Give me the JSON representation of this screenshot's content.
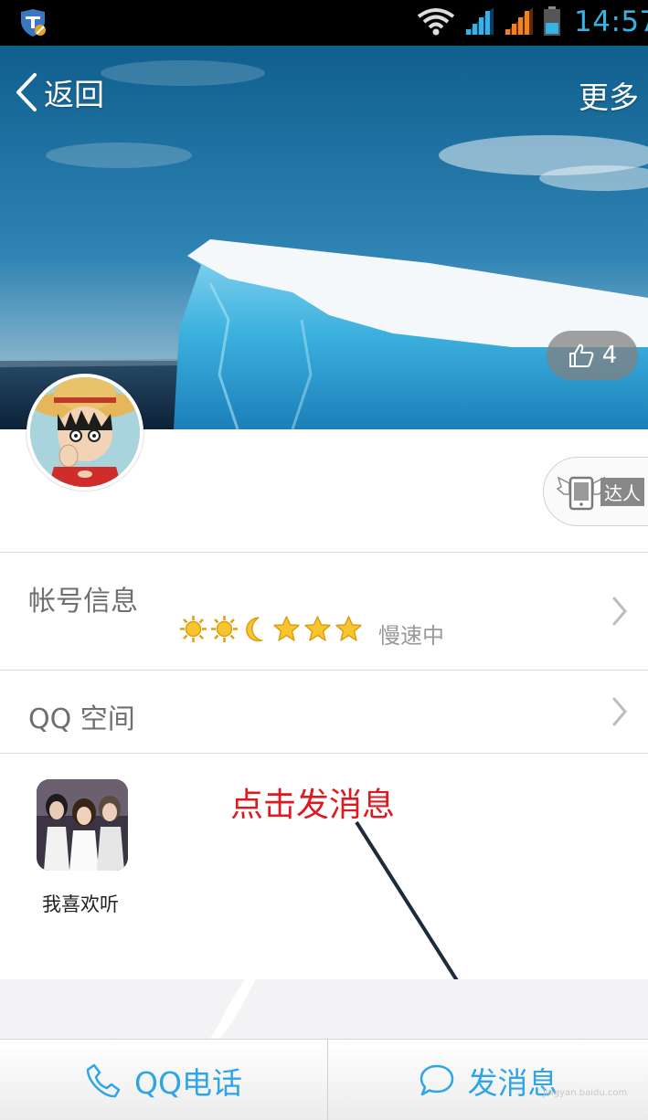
{
  "status_bar": {
    "time": "14:57"
  },
  "header": {
    "back_label": "返回",
    "more_label": "更多"
  },
  "cover": {
    "likes": "4"
  },
  "profile": {
    "badge_label": "达人"
  },
  "account_row": {
    "label": "帐号信息",
    "level_icons": [
      "sun-icon",
      "sun-icon",
      "moon-icon",
      "star-icon",
      "star-icon",
      "star-icon"
    ],
    "speed_text": "慢速中"
  },
  "qzone_row": {
    "label": "QQ 空间"
  },
  "music": {
    "label": "我喜欢听"
  },
  "annotation": {
    "text": "点击发消息"
  },
  "bottom_bar": {
    "call_label": "QQ电话",
    "message_label": "发消息"
  },
  "watermark": {
    "text": "jingyan.baidu.com"
  },
  "colors": {
    "accent": "#2fa4e6",
    "annotation": "#e0191f",
    "status_time": "#34b4e4"
  }
}
